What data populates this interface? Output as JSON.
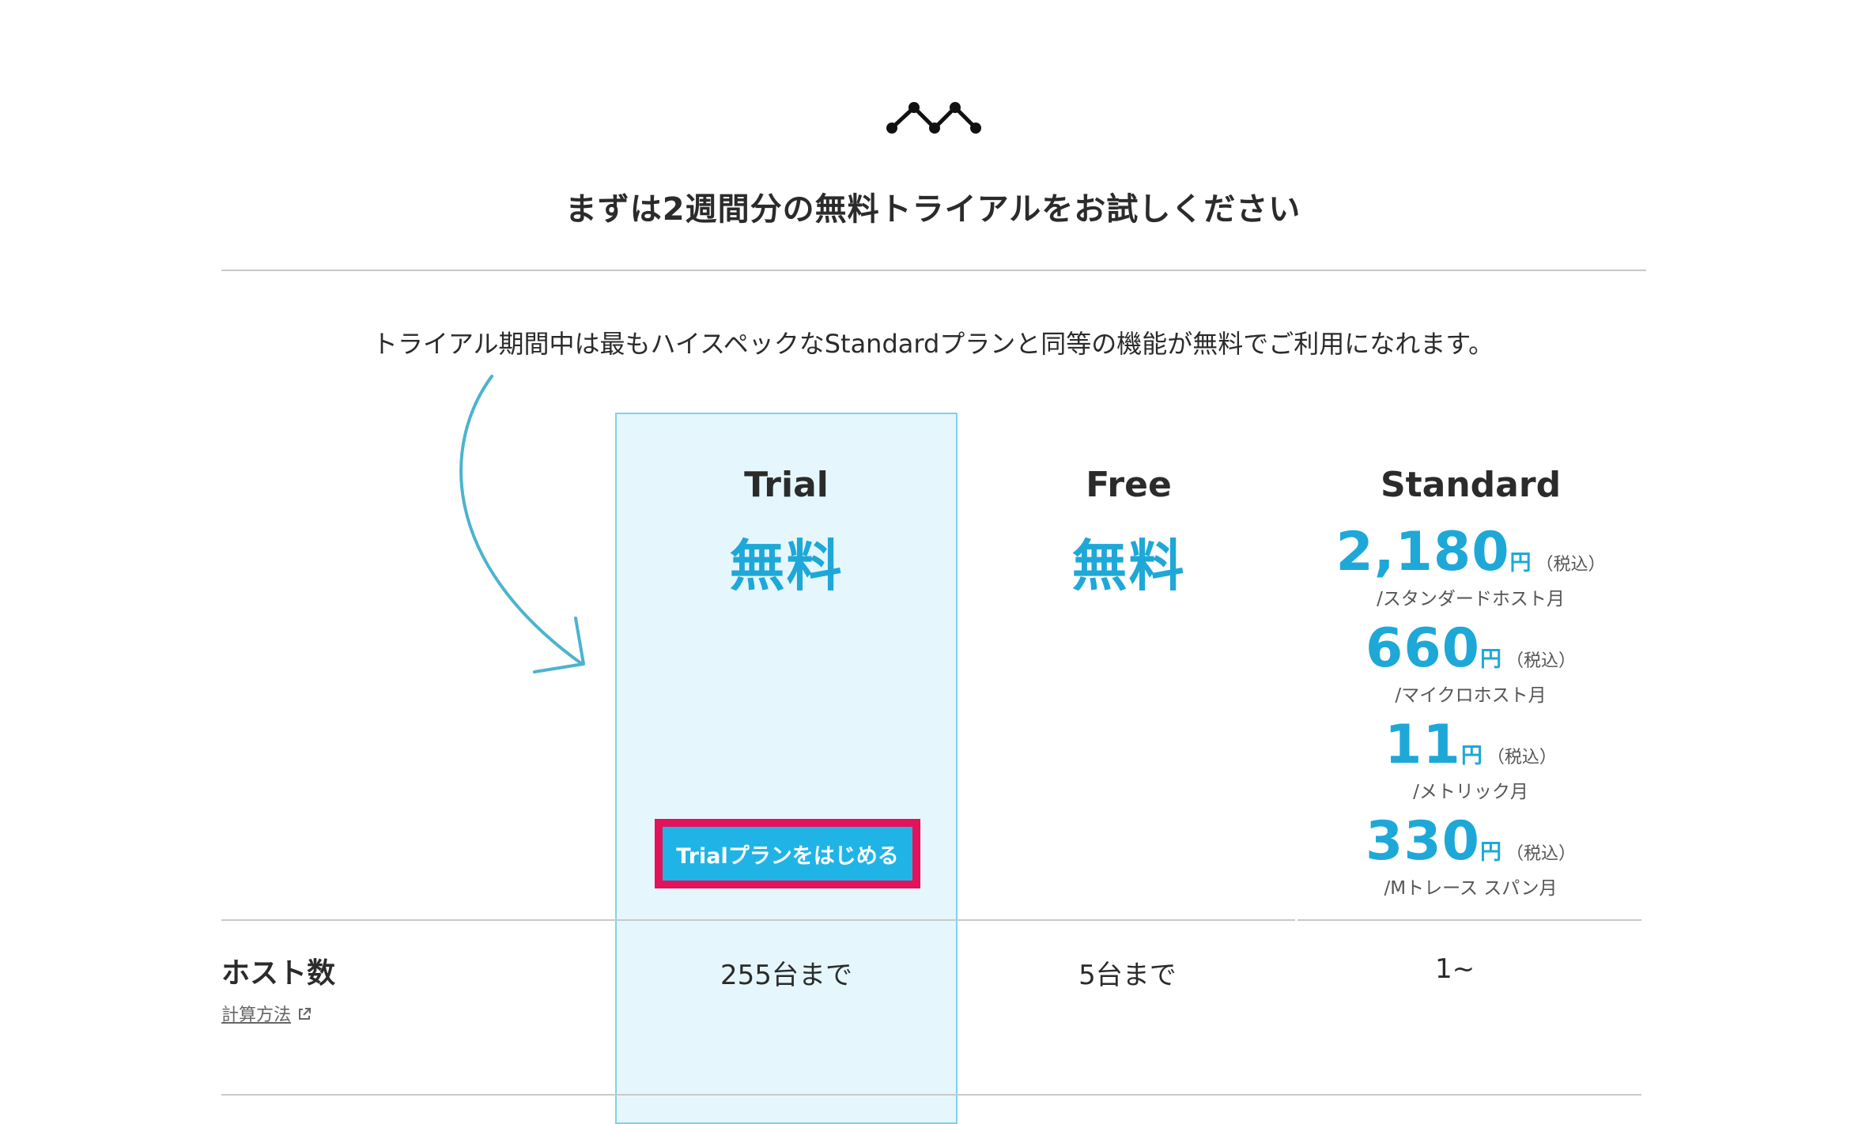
{
  "header": {
    "logo_icon": "mackerel-peaks-icon",
    "title": "まずは2週間分の無料トライアルをお試しください",
    "intro": "トライアル期間中は最もハイスペックなStandardプランと同等の機能が無料でご利用になれます。"
  },
  "plans": {
    "trial": {
      "name": "Trial",
      "price": "無料",
      "cta_label": "Trialプランをはじめる"
    },
    "free": {
      "name": "Free",
      "price": "無料"
    },
    "standard": {
      "name": "Standard",
      "prices": [
        {
          "amount": "2,180",
          "yen": "円",
          "tax": "（税込）",
          "unit": "/スタンダードホスト月"
        },
        {
          "amount": "660",
          "yen": "円",
          "tax": "（税込）",
          "unit": "/マイクロホスト月"
        },
        {
          "amount": "11",
          "yen": "円",
          "tax": "（税込）",
          "unit": "/メトリック月"
        },
        {
          "amount": "330",
          "yen": "円",
          "tax": "（税込）",
          "unit": "/Mトレース スパン月"
        }
      ]
    }
  },
  "table": {
    "rows": [
      {
        "label": "ホスト数",
        "link": "計算方法",
        "link_icon": "external-link-icon",
        "trial": "255台まで",
        "free": "5台まで",
        "standard": "1~"
      }
    ]
  },
  "colors": {
    "accent": "#1ea8d8",
    "trial_bg": "#e5f7fc",
    "cta_bg": "#20b4e6",
    "highlight": "#e4125a",
    "arrow": "#4cb3cf"
  }
}
